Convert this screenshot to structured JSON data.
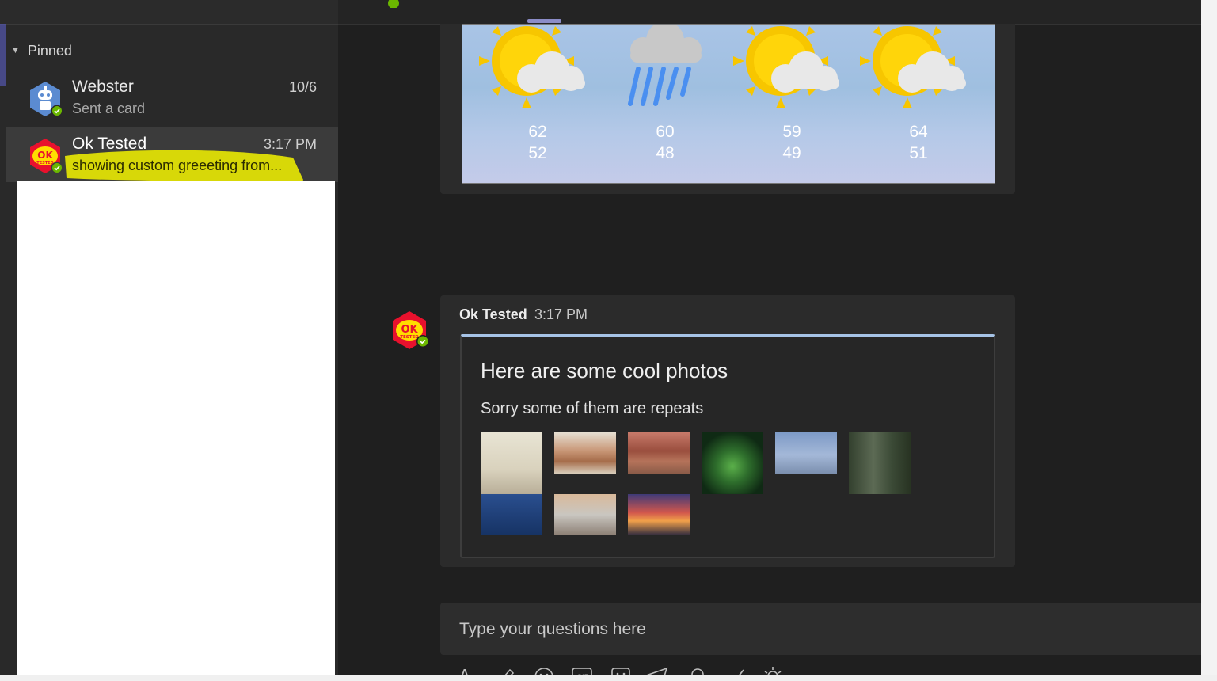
{
  "sidebar": {
    "section_label": "Pinned",
    "chats": [
      {
        "name": "Webster",
        "preview": "Sent a card",
        "time": "10/6"
      },
      {
        "name": "Ok Tested",
        "preview": "showing custom greeeting from...",
        "time": "3:17 PM"
      }
    ]
  },
  "weather": {
    "days": [
      {
        "condition": "partly-sunny-icon",
        "high": "62",
        "low": "52"
      },
      {
        "condition": "rain-icon",
        "high": "60",
        "low": "48"
      },
      {
        "condition": "partly-sunny-icon",
        "high": "59",
        "low": "49"
      },
      {
        "condition": "partly-sunny-icon",
        "high": "64",
        "low": "51"
      }
    ]
  },
  "message": {
    "sender": "Ok Tested",
    "time": "3:17 PM",
    "card_title": "Here are some cool photos",
    "card_subtitle": "Sorry some of them are repeats"
  },
  "compose": {
    "placeholder": "Type your questions here"
  },
  "avatar_badge": {
    "top": "OK",
    "bottom": "TESTED"
  },
  "colors": {
    "accent": "#5b5fc7",
    "highlight": "#f5f500",
    "presence": "#6bb700",
    "badge_red": "#e8112d",
    "badge_yellow": "#ffdd00"
  }
}
